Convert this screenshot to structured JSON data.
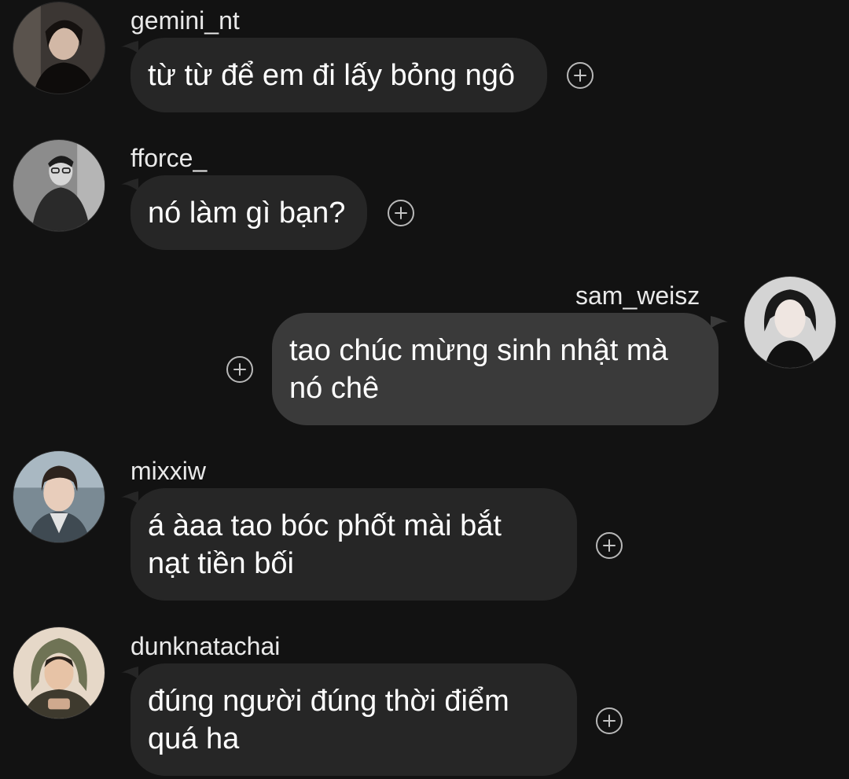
{
  "messages": [
    {
      "username": "gemini_nt",
      "text": "từ từ để em đi lấy bỏng ngô",
      "avatar_icon": "user-avatar-photo",
      "react_icon": "add-reaction-icon"
    },
    {
      "username": "fforce_",
      "text": "nó làm gì bạn?",
      "avatar_icon": "user-avatar-photo",
      "react_icon": "add-reaction-icon"
    },
    {
      "username": "sam_weisz",
      "text": "tao chúc mừng sinh nhật mà\nnó chê",
      "avatar_icon": "user-avatar-photo",
      "react_icon": "add-reaction-icon"
    },
    {
      "username": "mixxiw",
      "text": "á àaa tao bóc phốt mài bắt\nnạt tiền bối",
      "avatar_icon": "user-avatar-photo",
      "react_icon": "add-reaction-icon"
    },
    {
      "username": "dunknatachai",
      "text": "đúng người đúng thời điểm\nquá ha",
      "avatar_icon": "user-avatar-photo",
      "react_icon": "add-reaction-icon"
    }
  ],
  "colors": {
    "background": "#121212",
    "bubble_incoming": "#262626",
    "bubble_outgoing": "#3a3a3a",
    "text": "#ffffff",
    "username": "#e9e9e9",
    "icon": "#b8b8b8"
  }
}
